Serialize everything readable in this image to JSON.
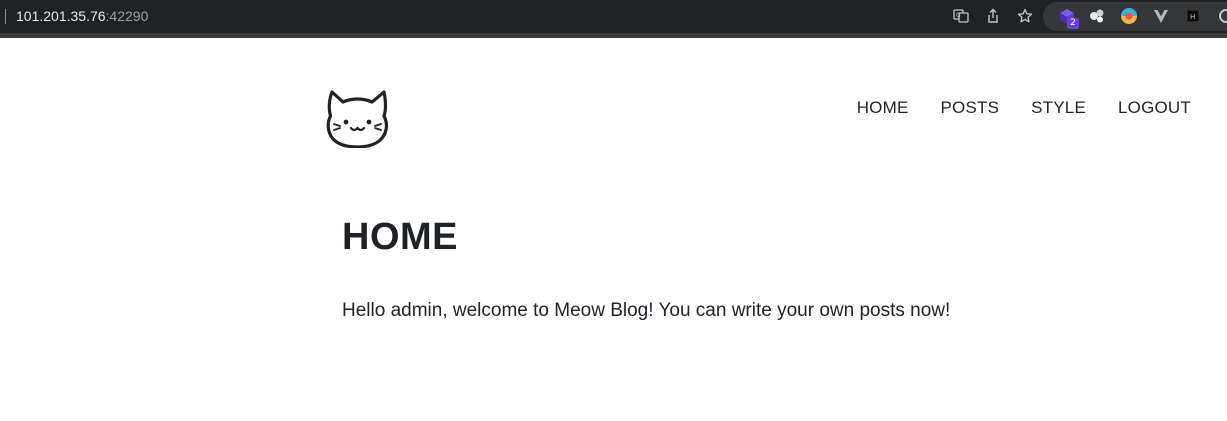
{
  "browser": {
    "url_host": "101.201.35.76",
    "url_port": ":42290",
    "extension_badge": "2"
  },
  "nav": {
    "items": [
      "HOME",
      "POSTS",
      "STYLE",
      "LOGOUT"
    ]
  },
  "main": {
    "title": "HOME",
    "body": "Hello admin, welcome to Meow Blog! You can write your own posts now!"
  },
  "colors": {
    "text": "#1f2328",
    "browser_bar": "#202124"
  }
}
